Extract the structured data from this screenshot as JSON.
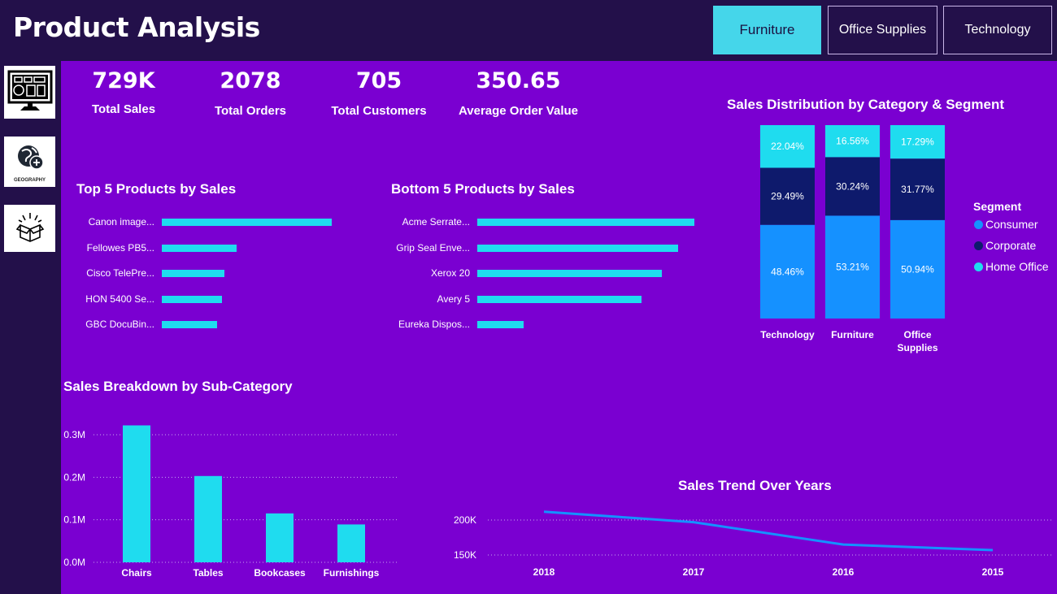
{
  "header": {
    "title": "Product Analysis",
    "category_buttons": [
      {
        "label": "Furniture",
        "active": true
      },
      {
        "label": "Office Supplies",
        "active": false
      },
      {
        "label": "Technology",
        "active": false
      }
    ]
  },
  "sidebar": {
    "items": [
      {
        "icon": "dashboard-monitor-icon"
      },
      {
        "icon": "globe-icon",
        "label": "GEOGRAPHY"
      },
      {
        "icon": "open-box-icon"
      }
    ]
  },
  "kpis": [
    {
      "value": "729K",
      "label": "Total Sales"
    },
    {
      "value": "2078",
      "label": "Total Orders"
    },
    {
      "value": "705",
      "label": "Total Customers"
    },
    {
      "value": "350.65",
      "label": "Average Order Value"
    }
  ],
  "top5": {
    "title": "Top 5 Products by Sales",
    "items": [
      {
        "label": "Canon image...",
        "value": 1.0
      },
      {
        "label": "Fellowes PB5...",
        "value": 0.44
      },
      {
        "label": "Cisco TelePre...",
        "value": 0.37
      },
      {
        "label": "HON 5400 Se...",
        "value": 0.355
      },
      {
        "label": "GBC DocuBin...",
        "value": 0.325
      }
    ]
  },
  "bottom5": {
    "title": "Bottom 5 Products by Sales",
    "items": [
      {
        "label": "Acme Serrate...",
        "value": 1.0
      },
      {
        "label": "Grip Seal Enve...",
        "value": 0.925
      },
      {
        "label": "Xerox 20",
        "value": 0.85
      },
      {
        "label": "Avery 5",
        "value": 0.755
      },
      {
        "label": "Eureka Dispos...",
        "value": 0.215
      }
    ]
  },
  "distribution": {
    "title": "Sales Distribution by Category & Segment",
    "legend_title": "Segment",
    "segments": [
      {
        "name": "Consumer",
        "color": "#1591ff"
      },
      {
        "name": "Corporate",
        "color": "#0e1a6c"
      },
      {
        "name": "Home Office",
        "color": "#1fdcef"
      }
    ],
    "categories": [
      {
        "name": "Technology",
        "values": [
          48.46,
          29.49,
          22.04
        ],
        "labels": [
          "48.46%",
          "29.49%",
          "22.04%"
        ]
      },
      {
        "name": "Furniture",
        "values": [
          53.21,
          30.24,
          16.56
        ],
        "labels": [
          "53.21%",
          "30.24%",
          "16.56%"
        ]
      },
      {
        "name": "Office Supplies",
        "values": [
          50.94,
          31.77,
          17.29
        ],
        "labels": [
          "50.94%",
          "31.77%",
          "17.29%"
        ]
      }
    ]
  },
  "subcategory": {
    "title": "Sales Breakdown by Sub-Category",
    "ticks": [
      "0.0M",
      "0.1M",
      "0.2M",
      "0.3M"
    ]
  },
  "trend": {
    "title": "Sales Trend Over Years",
    "ticks": [
      "150K",
      "200K"
    ]
  },
  "chart_data": [
    {
      "type": "bar",
      "title": "Sales Breakdown by Sub-Category",
      "categories": [
        "Chairs",
        "Tables",
        "Bookcases",
        "Furnishings"
      ],
      "values": [
        0.322,
        0.203,
        0.115,
        0.089
      ],
      "yunit": "M",
      "ylim": [
        0,
        0.3
      ],
      "yticks": [
        "0.0M",
        "0.1M",
        "0.2M",
        "0.3M"
      ],
      "grid": true
    },
    {
      "type": "line",
      "title": "Sales Trend Over Years",
      "x": [
        "2018",
        "2017",
        "2016",
        "2015"
      ],
      "values": [
        212000,
        197000,
        165000,
        157000
      ],
      "ylim": [
        150000,
        200000
      ],
      "yticks": [
        "150K",
        "200K"
      ],
      "grid": true,
      "color": "#1591ff"
    }
  ]
}
